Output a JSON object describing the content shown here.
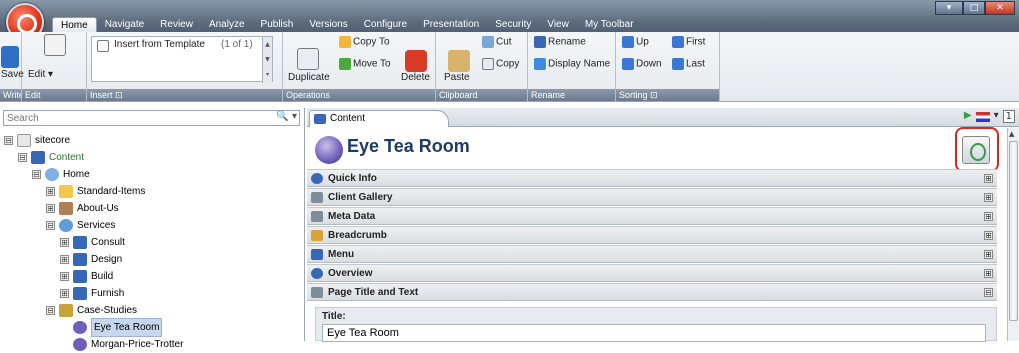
{
  "window": {
    "min": "▾",
    "max": "□",
    "close": "✕"
  },
  "tabs": [
    "Home",
    "Navigate",
    "Review",
    "Analyze",
    "Publish",
    "Versions",
    "Configure",
    "Presentation",
    "Security",
    "View",
    "My Toolbar"
  ],
  "ribbon": {
    "write": {
      "save": "Save",
      "label": "Write"
    },
    "edit": {
      "edit": "Edit ▾",
      "label": "Edit"
    },
    "insert": {
      "template": "Insert from Template",
      "counter": "(1 of 1)",
      "label": "Insert ⊡"
    },
    "operations": {
      "duplicate": "Duplicate",
      "copy_to": "Copy To",
      "move_to": "Move To",
      "delete": "Delete",
      "label": "Operations"
    },
    "clipboard": {
      "paste": "Paste",
      "cut": "Cut",
      "copy": "Copy",
      "label": "Clipboard"
    },
    "rename": {
      "rename": "Rename",
      "display_name": "Display Name",
      "label": "Rename"
    },
    "sorting": {
      "up": "Up",
      "down": "Down",
      "first": "First",
      "last": "Last",
      "label": "Sorting ⊡"
    }
  },
  "search": {
    "placeholder": "Search"
  },
  "tree": [
    {
      "label": "sitecore",
      "exp": "⊟",
      "color": "#e6e6e6"
    },
    {
      "label": "Content",
      "exp": "⊟",
      "color": "#3867b5"
    },
    {
      "label": "Home",
      "exp": "⊟",
      "color": "#7fb0e4"
    },
    {
      "label": "Standard-Items",
      "exp": "⊞",
      "color": "#f2c94c"
    },
    {
      "label": "About-Us",
      "exp": "⊞",
      "color": "#b07f55"
    },
    {
      "label": "Services",
      "exp": "⊟",
      "color": "#5f9ed9"
    },
    {
      "label": "Consult",
      "exp": "⊞",
      "color": "#3867b5"
    },
    {
      "label": "Design",
      "exp": "⊞",
      "color": "#3867b5"
    },
    {
      "label": "Build",
      "exp": "⊞",
      "color": "#3867b5"
    },
    {
      "label": "Furnish",
      "exp": "⊞",
      "color": "#3867b5"
    },
    {
      "label": "Case-Studies",
      "exp": "⊟",
      "color": "#c9a23a"
    },
    {
      "label": "Eye Tea Room",
      "exp": "",
      "color": "#6e5fb8"
    },
    {
      "label": "Morgan-Price-Trotter",
      "exp": "",
      "color": "#6e5fb8"
    }
  ],
  "content": {
    "tab": "Content",
    "lang": "▾",
    "version": "1",
    "title": "Eye Tea Room",
    "sections": [
      {
        "label": "Quick Info",
        "tog": "⊞",
        "color": "#3867b5"
      },
      {
        "label": "Client Gallery",
        "tog": "⊞",
        "color": "#7f8c99"
      },
      {
        "label": "Meta Data",
        "tog": "⊞",
        "color": "#7f8c99"
      },
      {
        "label": "Breadcrumb",
        "tog": "⊞",
        "color": "#d9a23a"
      },
      {
        "label": "Menu",
        "tog": "⊞",
        "color": "#3867b5"
      },
      {
        "label": "Overview",
        "tog": "⊞",
        "color": "#3867b5"
      },
      {
        "label": "Page Title and Text",
        "tog": "⊟",
        "color": "#7f8c99"
      }
    ],
    "field": {
      "label": "Title:",
      "value": "Eye Tea Room"
    }
  }
}
